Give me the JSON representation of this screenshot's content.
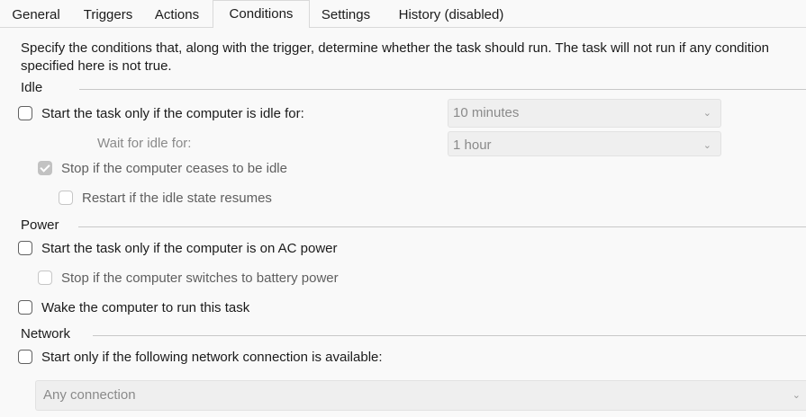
{
  "tabs": [
    {
      "label": "General"
    },
    {
      "label": "Triggers"
    },
    {
      "label": "Actions"
    },
    {
      "label": "Conditions"
    },
    {
      "label": "Settings"
    },
    {
      "label": "History (disabled)"
    }
  ],
  "active_tab": "Conditions",
  "description": "Specify the conditions that, along with the trigger, determine whether the task should run.  The task will not run  if any condition specified here is not true.",
  "idle": {
    "group_label": "Idle",
    "start_if_idle_label": "Start the task only if the computer is idle for:",
    "start_if_idle_checked": false,
    "idle_duration_value": "10 minutes",
    "wait_label": "Wait for idle for:",
    "wait_value": "1 hour",
    "stop_if_ceases_label": "Stop if the computer ceases to be idle",
    "stop_if_ceases_checked": true,
    "restart_label": "Restart if the idle state resumes",
    "restart_checked": false
  },
  "power": {
    "group_label": "Power",
    "ac_power_label": "Start the task only if the computer is on AC power",
    "ac_power_checked": false,
    "battery_label": "Stop if the computer switches to battery power",
    "battery_checked": false,
    "wake_label": "Wake the computer to run this task",
    "wake_checked": false
  },
  "network": {
    "group_label": "Network",
    "network_label": "Start only if the following network connection is available:",
    "network_checked": false,
    "connection_value": "Any connection"
  },
  "icons": {
    "chevron": "chevron-down-icon",
    "check": "checkmark-icon"
  }
}
